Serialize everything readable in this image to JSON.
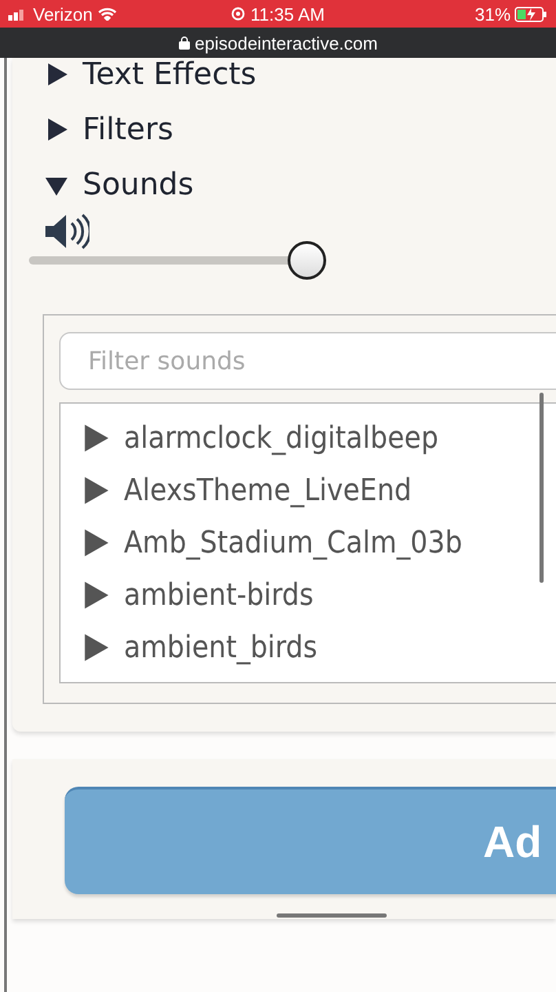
{
  "status_bar": {
    "carrier": "Verizon",
    "time": "11:35 AM",
    "battery": "31%"
  },
  "url_bar": {
    "url": "episodeinteractive.com"
  },
  "sections": [
    {
      "label": "Text Effects",
      "expanded": false
    },
    {
      "label": "Filters",
      "expanded": false
    },
    {
      "label": "Sounds",
      "expanded": true
    }
  ],
  "volume": {
    "level": 0.93
  },
  "sound_filter": {
    "placeholder": "Filter sounds"
  },
  "sounds": [
    "alarmclock_digitalbeep",
    "AlexsTheme_LiveEnd",
    "Amb_Stadium_Calm_03b",
    "ambient-birds",
    "ambient_birds"
  ],
  "add_button": {
    "label": "Ad"
  }
}
